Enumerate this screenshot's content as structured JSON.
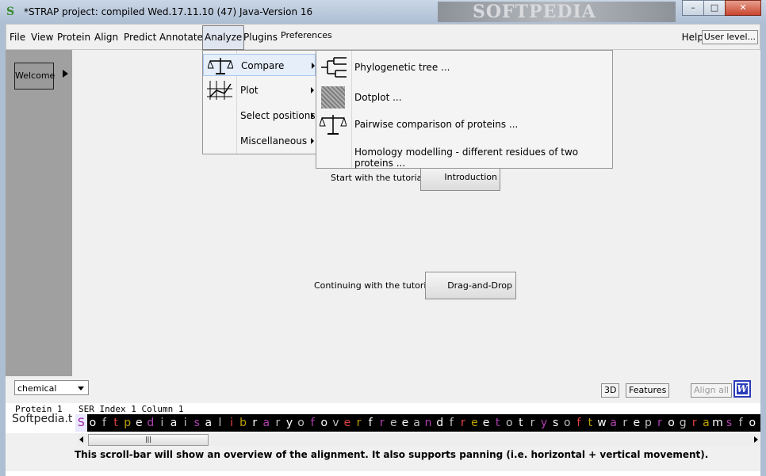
{
  "window": {
    "title": "*STRAP project:  compiled Wed.17.11.10  (47)  Java-Version 16",
    "watermark": "SOFTPEDIA",
    "controls": {
      "minimize": "–",
      "maximize": "□",
      "close": "✕"
    }
  },
  "menubar": {
    "items": [
      "File",
      "View",
      "Protein",
      "Align",
      "Predict",
      "Annotate",
      "Analyze",
      "Plugins",
      "Preferences"
    ],
    "help": "Help",
    "user_level": "User level..."
  },
  "sidebar": {
    "welcome": "Welcome"
  },
  "main": {
    "tutorial1_label": "Start with the tutorial",
    "tutorial1_button": "Introduction",
    "tutorial2_label": "Continuing with the tutorial",
    "tutorial2_button": "Drag-and-Drop"
  },
  "analyze_menu": {
    "items": [
      "Compare",
      "Plot",
      "Select positions",
      "Miscellaneous"
    ]
  },
  "compare_submenu": {
    "items": [
      "Phylogenetic tree ...",
      "Dotplot ...",
      "Pairwise comparison of proteins ...",
      "Homology modelling - different residues of two proteins ..."
    ]
  },
  "bottom": {
    "select_value": "chemical",
    "btn_3d": "3D",
    "btn_features": "Features",
    "btn_align_all": "Align all",
    "btn_w": "W"
  },
  "alignment": {
    "protein_header": "Protein 1",
    "residue_header": "SER  Index 1 Column 1",
    "protein_label": "Softpedia.t",
    "sequence": "SoftpediaisalibraryofoverfreeandfreetotrysoftwareprogramsforW",
    "colors": [
      "#b040b0",
      "#ffffff",
      "#c0c0c0",
      "#e04040",
      "#c0a000",
      "#ffffff",
      "#b040b0",
      "#c0c0c0",
      "#ffffff",
      "#c0c0c0"
    ]
  },
  "status_text": "This scroll-bar will show an overview of the alignment. It also supports panning (i.e. horizontal + vertical movement).",
  "scroll_thumb": "|||"
}
